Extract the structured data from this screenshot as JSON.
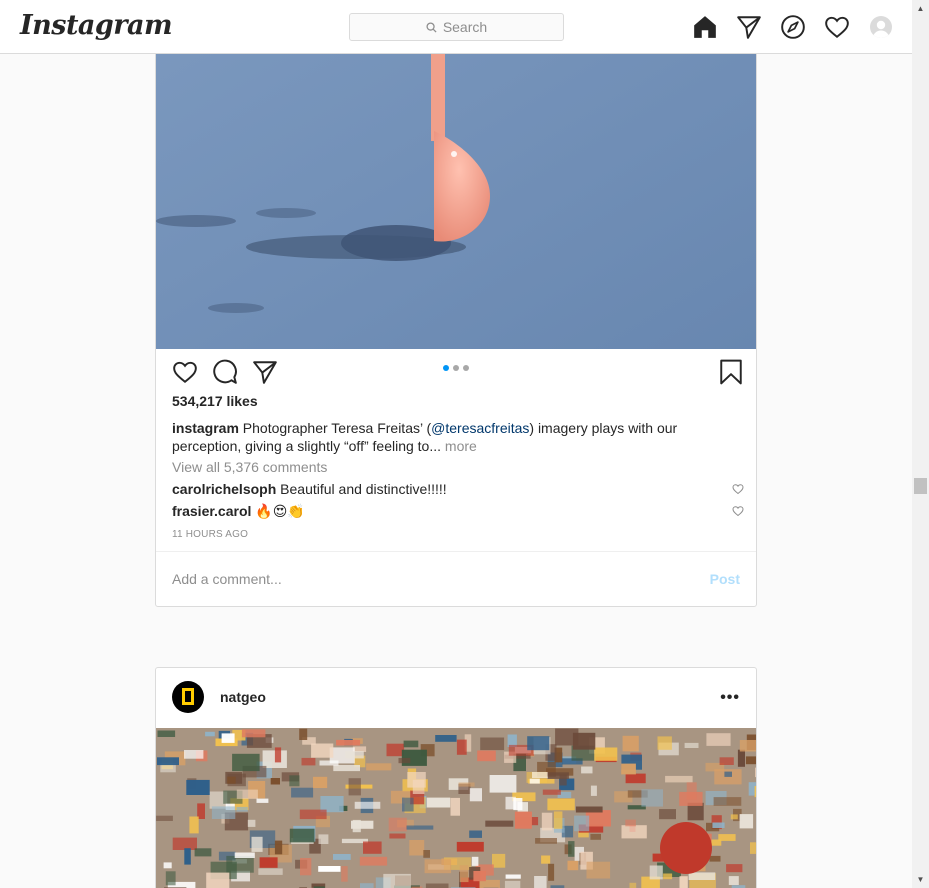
{
  "header": {
    "logo": "Instagram",
    "search_placeholder": "Search",
    "nav_icons": [
      "home-icon",
      "direct-icon",
      "explore-icon",
      "activity-icon",
      "profile-avatar"
    ]
  },
  "post1": {
    "likes": "534,217 likes",
    "caption": {
      "username": "instagram",
      "text_before": " Photographer Teresa Freitas’ (",
      "mention": "@teresacfreitas",
      "text_after": ") imagery plays with our perception, giving a slightly “off” feeling to...",
      "more": " more"
    },
    "view_all": "View all 5,376 comments",
    "comments": [
      {
        "username": "carolrichelsoph",
        "text": " Beautiful and distinctive!!!!!"
      },
      {
        "username": "frasier.carol",
        "text": " 🔥😍👏"
      }
    ],
    "timestamp": "11 HOURS AGO",
    "add_comment_placeholder": "Add a comment...",
    "post_label": "Post",
    "carousel": {
      "count": 3,
      "active": 0
    }
  },
  "post2": {
    "username": "natgeo",
    "more_label": "•••"
  },
  "colors": {
    "accent": "#0095f6",
    "post_disabled": "#b2dffc",
    "mention": "#00376b",
    "photo1_bg": "#6e8db7",
    "spoon": "#f2a48e"
  }
}
